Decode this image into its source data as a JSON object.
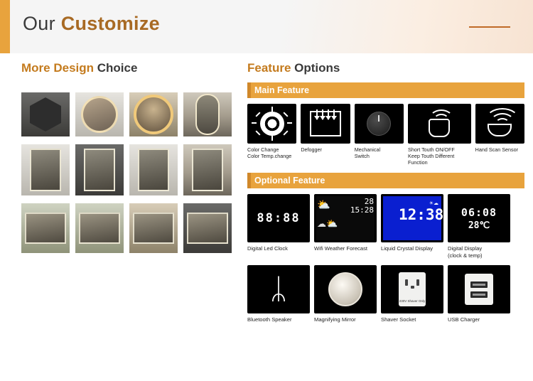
{
  "header": {
    "title_plain": "Our ",
    "title_bold": "Customize"
  },
  "left": {
    "title_accent": "More Design",
    "title_plain": " Choice",
    "rows": [
      {
        "name": "mirror-row-1",
        "items": [
          "hexagon-frameless-mirror",
          "round-backlit-mirror",
          "round-warm-led-mirror",
          "oval-led-mirror"
        ]
      },
      {
        "name": "mirror-row-2",
        "items": [
          "rectangle-vertical-mirror-1",
          "rectangle-vertical-mirror-2",
          "rectangle-vertical-mirror-3",
          "rectangle-vertical-mirror-4"
        ]
      },
      {
        "name": "mirror-row-3",
        "items": [
          "rectangle-horizontal-mirror-1",
          "rectangle-horizontal-mirror-2",
          "rectangle-horizontal-mirror-3",
          "rectangle-horizontal-mirror-4"
        ]
      }
    ]
  },
  "right": {
    "title_accent": "Feature",
    "title_plain": " Options",
    "main_bar": "Main Feature",
    "optional_bar": "Optional Feature",
    "main_features": [
      {
        "icon": "sun-brightness-icon",
        "caption": "Color Change\nColor Temp.change"
      },
      {
        "icon": "defogger-icon",
        "caption": "Defogger"
      },
      {
        "icon": "mechanical-switch-icon",
        "caption": "Mechanical\nSwitch"
      },
      {
        "icon": "touch-sensor-icon",
        "caption": "Short Touth ON/OFF\nKeep Touth Different\nFunction"
      },
      {
        "icon": "hand-scan-sensor-icon",
        "caption": "Hand Scan Sensor"
      }
    ],
    "optional_row1": [
      {
        "icon": "digital-led-clock-icon",
        "caption": "Digital Led Clock",
        "display": "88:88"
      },
      {
        "icon": "wifi-weather-forecast-icon",
        "caption": "Wifi Weather Forecast",
        "time": "15:28",
        "temp": "28"
      },
      {
        "icon": "liquid-crystal-display-icon",
        "caption": "Liquid Crystal Display",
        "display": "12:38"
      },
      {
        "icon": "digital-display-icon",
        "caption": "Digital Display\n(clock & temp)",
        "time": "06:08",
        "temp": "28℃"
      }
    ],
    "optional_row2": [
      {
        "icon": "bluetooth-speaker-icon",
        "caption": "Bluetooth Speaker",
        "glyph": "ᛦ"
      },
      {
        "icon": "magnifying-mirror-icon",
        "caption": "Magnifying Mirror"
      },
      {
        "icon": "shaver-socket-icon",
        "caption": "Shaver Socket",
        "label": "230V\nShaver Only"
      },
      {
        "icon": "usb-charger-icon",
        "caption": "USB Charger"
      }
    ]
  }
}
